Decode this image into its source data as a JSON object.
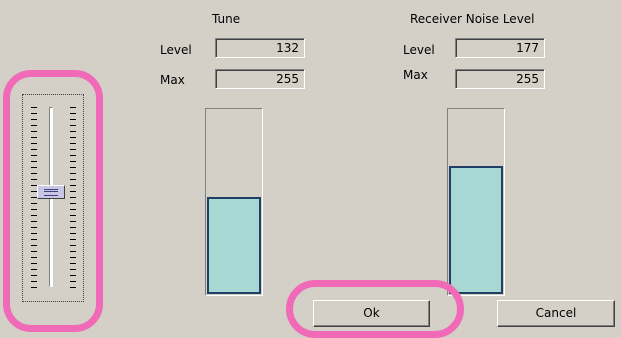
{
  "tune": {
    "title": "Tune",
    "level_label": "Level",
    "level_value": "132",
    "max_label": "Max",
    "max_value": "255",
    "meter_fraction": 0.52
  },
  "noise": {
    "title": "Receiver Noise Level",
    "level_label": "Level",
    "level_value": "177",
    "max_label": "Max",
    "max_value": "255",
    "meter_fraction": 0.69
  },
  "slider": {
    "position_fraction": 0.47
  },
  "buttons": {
    "ok_label": "Ok",
    "cancel_label": "Cancel"
  },
  "colors": {
    "meter_fill": "#a7d8d4",
    "meter_border": "#1f3f66",
    "highlight": "#f06ab8",
    "dialog_bg": "#d4d0c8"
  }
}
